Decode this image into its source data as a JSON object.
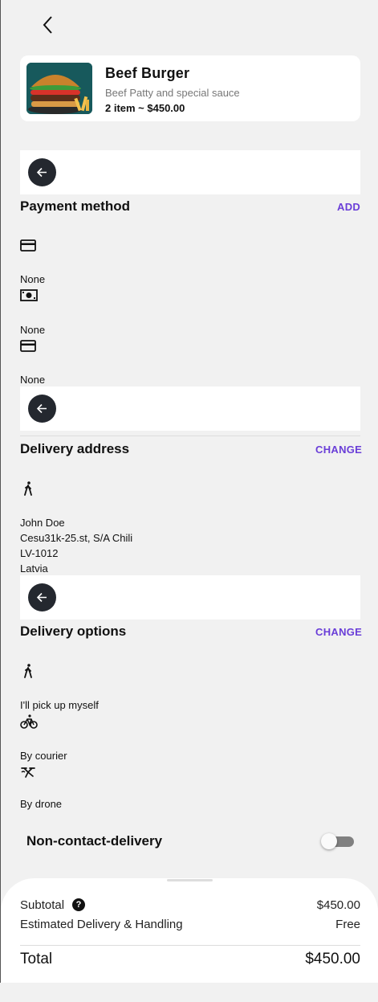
{
  "product": {
    "name": "Beef Burger",
    "description": "Beef Patty and special sauce",
    "quantity_price": "2 item ~ $450.00"
  },
  "payment": {
    "title": "Payment method",
    "action": "ADD",
    "methods": [
      {
        "icon": "credit-card-icon",
        "label": "None"
      },
      {
        "icon": "cash-icon",
        "label": "None"
      },
      {
        "icon": "credit-card-icon",
        "label": "None"
      }
    ]
  },
  "address": {
    "title": "Delivery address",
    "action": "CHANGE",
    "icon": "walking-person-icon",
    "lines": [
      "John Doe",
      "Cesu31k-25.st, S/A Chili",
      "LV-1012",
      "Latvia"
    ]
  },
  "delivery": {
    "title": "Delivery options",
    "action": "CHANGE",
    "options": [
      {
        "icon": "walking-person-icon",
        "label": "I'll pick up myself"
      },
      {
        "icon": "bicycle-icon",
        "label": "By courier"
      },
      {
        "icon": "drone-icon",
        "label": "By drone"
      }
    ]
  },
  "non_contact": {
    "label": "Non-contact-delivery",
    "enabled": false
  },
  "summary": {
    "subtotal_label": "Subtotal",
    "subtotal_value": "$450.00",
    "help_glyph": "?",
    "delivery_label": "Estimated Delivery & Handling",
    "delivery_value": "Free",
    "total_label": "Total",
    "total_value": "$450.00"
  },
  "colors": {
    "accent": "#6a3ed8",
    "background": "#f1f1f1",
    "dark_button": "#24282f"
  }
}
